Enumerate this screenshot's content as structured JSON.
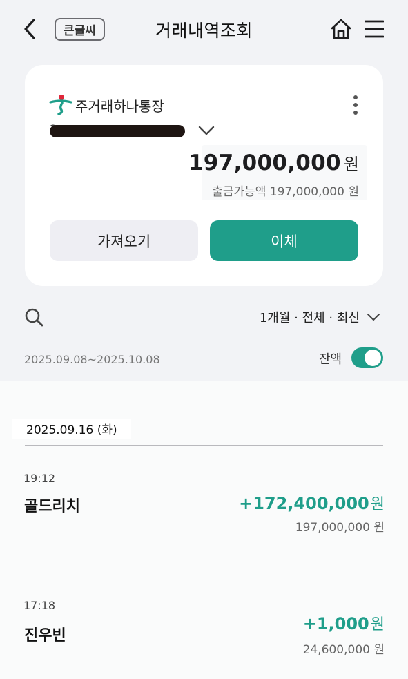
{
  "header": {
    "title": "거래내역조회",
    "big_text_label": "큰글씨"
  },
  "account": {
    "name": "주거래하나통장",
    "number_masked": "2",
    "balance": "197,000,000",
    "balance_unit": "원",
    "available_text": "출금가능액 197,000,000 원",
    "import_label": "가져오기",
    "transfer_label": "이체"
  },
  "filter": {
    "label": "1개월 · 전체 · 최신",
    "date_range": "2025.09.08~2025.10.08",
    "balance_toggle_label": "잔액",
    "balance_toggle_on": true
  },
  "transactions": {
    "date": "2025.09.16 (화)",
    "items": [
      {
        "time": "19:12",
        "name": "골드리치",
        "amount": "+172,400,000",
        "unit": "원",
        "balance_after": "197,000,000 원"
      },
      {
        "time": "17:18",
        "name": "진우빈",
        "amount": "+1,000",
        "unit": "원",
        "balance_after": "24,600,000 원"
      }
    ]
  },
  "colors": {
    "accent": "#1f9e8a",
    "background": "#f2f3f6"
  }
}
